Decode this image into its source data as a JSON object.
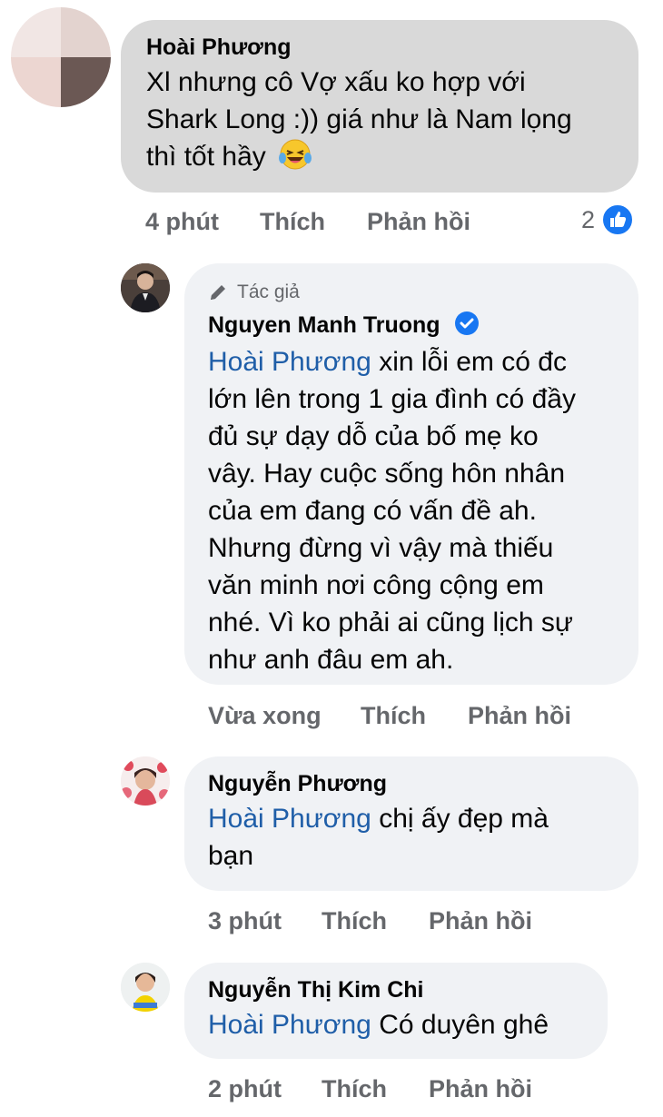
{
  "comments": [
    {
      "author": "Hoài Phương",
      "lines": [
        "Xl nhưng cô Vợ xấu ko hợp với",
        "Shark Long  :)) giá như là Nam lọng",
        "thì tốt hầy"
      ],
      "emoji": "laughing-tears-emoji",
      "time": "4 phút",
      "like": "Thích",
      "reply": "Phản hồi",
      "reaction_count": "2"
    },
    {
      "author_badge": "Tác giả",
      "author": "Nguyen Manh Truong",
      "mention": "Hoài Phương",
      "first_line_rest": " xin lỗi em có đc",
      "lines": [
        "lớn lên trong 1 gia đình có đầy",
        "đủ sự dạy dỗ của bố mẹ ko",
        "vây. Hay cuộc sống hôn nhân",
        "của em đang có vấn đề ah.",
        "Nhưng đừng vì vậy mà thiếu",
        "văn minh nơi công cộng em",
        "nhé. Vì ko phải ai cũng lịch sự",
        "như anh đâu em ah."
      ],
      "time": "Vừa xong",
      "like": "Thích",
      "reply": "Phản hồi"
    },
    {
      "author": "Nguyễn Phương",
      "mention": "Hoài Phương",
      "first_line_rest": " chị ấy đẹp mà",
      "lines": [
        "bạn"
      ],
      "time": "3 phút",
      "like": "Thích",
      "reply": "Phản hồi"
    },
    {
      "author": "Nguyễn Thị Kim Chi",
      "mention": "Hoài Phương",
      "first_line_rest": " Có duyên ghê",
      "time": "2 phút",
      "like": "Thích",
      "reply": "Phản hồi"
    }
  ],
  "colors": {
    "bubble_gray": "#d9d9d9",
    "bubble_light": "#f0f2f5",
    "mention_blue": "#1f5ea8",
    "meta_gray": "#65676b",
    "like_blue": "#1877f2"
  }
}
